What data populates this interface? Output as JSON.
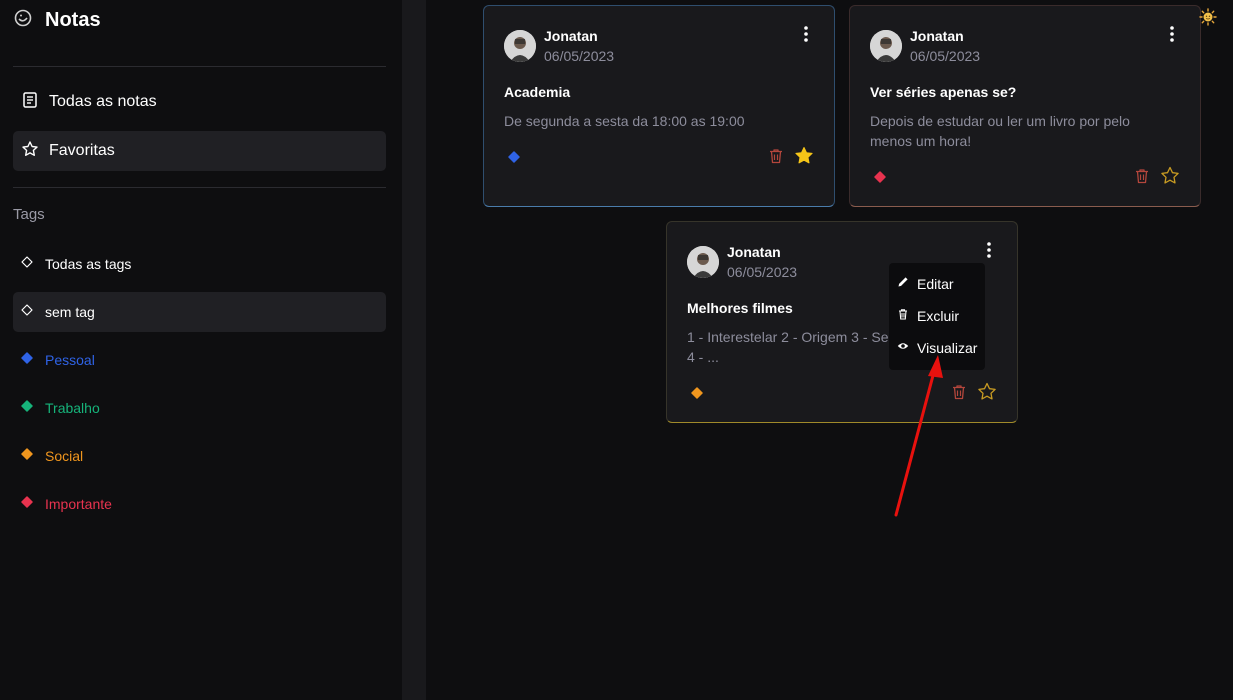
{
  "app": {
    "title": "Notas"
  },
  "sidebar": {
    "nav": [
      {
        "label": "Todas as notas",
        "icon": "notes-icon",
        "active": false
      },
      {
        "label": "Favoritas",
        "icon": "star-icon",
        "active": true
      }
    ],
    "tags_heading": "Tags",
    "tags": [
      {
        "label": "Todas as tags",
        "color": "#ffffff",
        "active": false
      },
      {
        "label": "sem tag",
        "color": "#ffffff",
        "active": true
      },
      {
        "label": "Pessoal",
        "color": "#2f63e6"
      },
      {
        "label": "Trabalho",
        "color": "#16b37a"
      },
      {
        "label": "Social",
        "color": "#f0961e"
      },
      {
        "label": "Importante",
        "color": "#e8334f"
      }
    ]
  },
  "notes": [
    {
      "author": "Jonatan",
      "date": "06/05/2023",
      "title": "Academia",
      "body": "De segunda a sesta da 18:00 as 19:00",
      "tag_color": "#2f63e6",
      "favorite": true
    },
    {
      "author": "Jonatan",
      "date": "06/05/2023",
      "title": "Ver séries apenas se?",
      "body": "Depois de estudar ou ler um livro por pelo menos um hora!",
      "tag_color": "#e8334f",
      "favorite": false
    },
    {
      "author": "Jonatan",
      "date": "06/05/2023",
      "title": "Melhores filmes",
      "body_line1": "1 - Interestelar 2 - Origem 3 - Se",
      "body_line2": "4 - ...",
      "tag_color": "#f0961e",
      "favorite": false
    }
  ],
  "menu": {
    "items": [
      {
        "label": "Editar",
        "icon": "pencil-icon"
      },
      {
        "label": "Excluir",
        "icon": "trash-icon"
      },
      {
        "label": "Visualizar",
        "icon": "eye-icon"
      }
    ]
  },
  "colors": {
    "trash": "#b4463c",
    "star_favorite": "#f5c518",
    "star_outline": "#c89b22",
    "annotation_arrow": "#e8110e"
  }
}
